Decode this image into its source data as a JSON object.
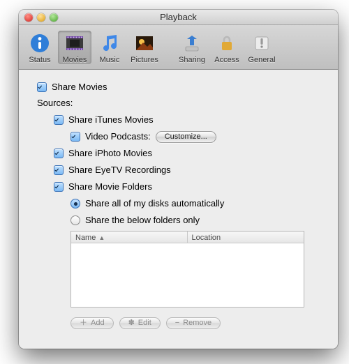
{
  "window": {
    "title": "Playback"
  },
  "toolbar": {
    "items": [
      {
        "label": "Status",
        "selected": false
      },
      {
        "label": "Movies",
        "selected": true
      },
      {
        "label": "Music",
        "selected": false
      },
      {
        "label": "Pictures",
        "selected": false
      },
      {
        "label": "Sharing",
        "selected": false
      },
      {
        "label": "Access",
        "selected": false
      },
      {
        "label": "General",
        "selected": false
      }
    ]
  },
  "main": {
    "share_movies": {
      "label": "Share Movies",
      "checked": true
    },
    "sources_label": "Sources:",
    "share_itunes": {
      "label": "Share iTunes Movies",
      "checked": true
    },
    "video_podcasts": {
      "label": "Video Podcasts:",
      "checked": true
    },
    "customize_button": "Customize...",
    "share_iphoto": {
      "label": "Share iPhoto Movies",
      "checked": true
    },
    "share_eyetv": {
      "label": "Share EyeTV Recordings",
      "checked": true
    },
    "share_folders": {
      "label": "Share Movie Folders",
      "checked": true
    },
    "radio_all": {
      "label": "Share all of my disks automatically",
      "selected": true
    },
    "radio_below": {
      "label": "Share the below folders only",
      "selected": false
    },
    "table": {
      "col_name": "Name",
      "col_location": "Location",
      "rows": []
    },
    "add_button": "Add",
    "edit_button": "Edit",
    "remove_button": "Remove"
  }
}
